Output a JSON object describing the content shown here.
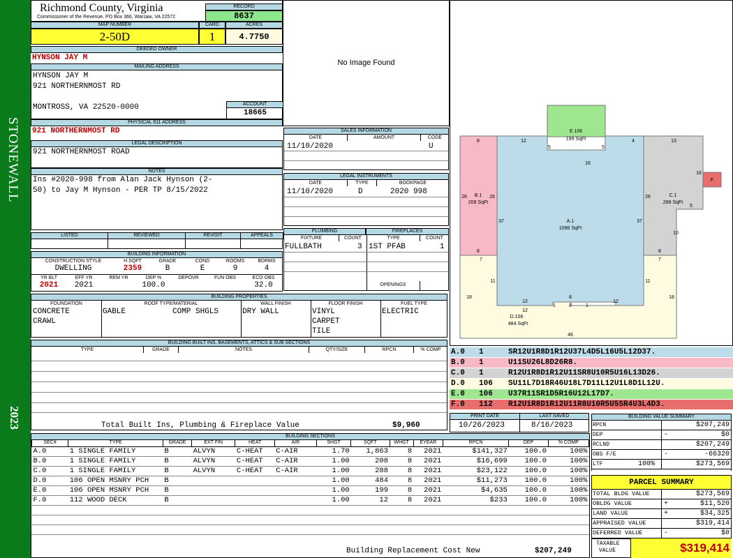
{
  "sidebar": {
    "district": "STONEWALL",
    "year": "2023",
    "color": "#0a7a1a"
  },
  "header": {
    "county": "Richmond County, Virginia",
    "office": "Commissioner of the Revenue, PO Box 366, Warsaw, VA 22572",
    "record_label": "RECORD",
    "record": "8637",
    "map_label": "MAP NUMBER",
    "map_number": "2-50D",
    "card_label": "CARD",
    "card": "1",
    "acres_label": "ACRES",
    "acres": "4.7750"
  },
  "owner": {
    "label": "DEEDED OWNER",
    "name": "HYNSON JAY M"
  },
  "mailing": {
    "label": "MAILING ADDRESS",
    "line1": "HYNSON JAY M",
    "line2": "921 NORTHERNMOST RD",
    "line3": "MONTROSS, VA 22520-0000"
  },
  "account": {
    "label": "ACCOUNT",
    "value": "18665"
  },
  "physical": {
    "label": "PHYSICAL 911 ADDRESS",
    "value": "921 NORTHERNMOST RD"
  },
  "legal": {
    "label": "LEGAL DESCRIPTION",
    "value": "921 NORTHERNMOST ROAD"
  },
  "notes": {
    "label": "NOTES",
    "line1": "Ins #2020-998 from Alan Jack Hynson (2-",
    "line2": "50) to Jay M Hynson - PER TP 8/15/2022"
  },
  "review": {
    "listed": "LISTED",
    "reviewed": "REVIEWED",
    "revisit": "REVISIT",
    "appeals": "APPEALS"
  },
  "building": {
    "label": "BUILDING INFORMATION",
    "h_style": "CONSTRUCTION STYLE",
    "h_hsqft": "H SQFT",
    "h_grade": "GRADE",
    "h_cond": "COND",
    "h_rooms": "ROOMS",
    "h_bdrms": "BDRMS",
    "style": "DWELLING",
    "hsqft": "2359",
    "grade": "B",
    "cond": "E",
    "rooms": "9",
    "bdrms": "4",
    "h_yrblt": "YR BLT",
    "h_effyr": "EFF YR",
    "h_remyr": "REM YR",
    "h_dep": "DEP %",
    "h_depovr": "DEPOVR",
    "h_funobs": "FUN OBS",
    "h_ecoobs": "ECO OBS",
    "yrblt": "2021",
    "effyr": "2021",
    "remyr": "",
    "dep": "100.0",
    "depovr": "",
    "funobs": "",
    "ecoobs": "32.0"
  },
  "properties": {
    "label": "BUILDING PROPERTIES",
    "h_foundation": "FOUNDATION",
    "h_roof": "ROOF TYPE/MATERIAL",
    "h_wall": "WALL FINISH",
    "h_floor": "FLOOR FINISH",
    "h_fuel": "FUEL TYPE",
    "foundation1": "CONCRETE",
    "foundation2": "CRAWL",
    "roof_type": "GABLE",
    "roof_mat": "COMP SHGLS",
    "wall": "DRY WALL",
    "floor1": "VINYL",
    "floor2": "CARPET",
    "floor3": "TILE",
    "fuel": "ELECTRIC"
  },
  "builtins": {
    "label": "BUILDING BUILT INS, BASEMENTS, ATTICS & SUB SECTIONS",
    "h_type": "TYPE",
    "h_grade": "GRADE",
    "h_notes": "NOTES",
    "h_qty": "QTY/SIZE",
    "h_rpcn": "RPCN",
    "h_comp": "% COMP",
    "total_label": "Total Built Ins, Plumbing & Fireplace Value",
    "total": "$9,960"
  },
  "image": {
    "text": "No Image Found"
  },
  "sales": {
    "label": "SALES INFORMATION",
    "h_date": "DATE",
    "h_amount": "AMOUNT",
    "h_code": "CODE",
    "date": "11/10/2020",
    "amount": "",
    "code": "U"
  },
  "legal_inst": {
    "label": "LEGAL INSTRUMENTS",
    "h_date": "DATE",
    "h_type": "TYPE",
    "h_book": "BOOKPAGE",
    "date": "11/10/2020",
    "type": "D",
    "book": "2020 998"
  },
  "plumbing": {
    "label": "PLUMBING",
    "h_fixture": "FIXTURE",
    "h_count": "COUNT",
    "fixture": "FULLBATH",
    "count": "3"
  },
  "fireplaces": {
    "label": "FIREPLACES",
    "h_type": "TYPE",
    "h_count": "COUNT",
    "type": "1ST PFAB",
    "count": "1",
    "openings": "OPENINGS"
  },
  "sketch": {
    "labels": {
      "E": "E.106",
      "E_sq": "199 SqFt",
      "B": "B.1",
      "B_sq": "208 SqFt",
      "A": "A.1",
      "A_sq": "1096 SqFt",
      "C": "C.1",
      "C_sq": "288 SqFt",
      "D": "D.106",
      "D_sq": "484 SqFt",
      "F": "F"
    },
    "dims": {
      "b_top": "8",
      "a_top_l": "12",
      "e_l": "5",
      "e_r": "5",
      "e_b": "16",
      "a_top_r": "4",
      "c_top": "13",
      "f_l": "16",
      "b_l": "26",
      "b_r": "26",
      "c_l": "26",
      "c_r": "5",
      "a_l": "37",
      "a_r": "37",
      "c_bot": "10",
      "b_bot": "8",
      "c_b2": "8",
      "d_tl": "7",
      "d_tr": "7",
      "d_l": "11",
      "d_r": "11",
      "d_ls": "18",
      "d_rs": "18",
      "a_b1": "12",
      "a_b2": "8",
      "a_b3": "12",
      "a_b4": "12",
      "a_b5": "1",
      "a_b6": "8",
      "a_b7": "1",
      "d_bot": "46"
    },
    "colors": {
      "A": "#bcdce9",
      "B": "#f7b9c6",
      "C": "#d3d3d3",
      "D": "#fffbe0",
      "E": "#9ee68f",
      "F": "#e86d6d"
    }
  },
  "legend": [
    {
      "code": "A.0",
      "num": "1",
      "path": "SR12U1R8D1R12U37L4D5L16U5L12D37.",
      "color": "#bcdce9"
    },
    {
      "code": "B.0",
      "num": "1",
      "path": "U11SU26L8D26R8.",
      "color": "#f7b9c6"
    },
    {
      "code": "C.0",
      "num": "1",
      "path": "R12U1R8D1R12U11SR8U10R5U16L13D26.",
      "color": "#d3d3d3"
    },
    {
      "code": "D.0",
      "num": "106",
      "path": "SU11L7D18R46U18L7D11L12U1L8D1L12U.",
      "color": "#fffbe0"
    },
    {
      "code": "E.0",
      "num": "106",
      "path": "U37R11SR1D5R16U12L17D7.",
      "color": "#9ee68f"
    },
    {
      "code": "F.0",
      "num": "112",
      "path": "R12U1R8D1R12U11R8U10R5U5SR4U3L4D3.",
      "color": "#e86d6d"
    }
  ],
  "dates": {
    "h_print": "PRINT DATE",
    "h_saved": "LAST SAVED",
    "print": "10/26/2023",
    "saved": "8/16/2023"
  },
  "sections": {
    "label": "BUILDING SECTIONS",
    "headers": [
      "SEC#",
      "TYPE",
      "GRADE",
      "EXT FIN",
      "HEAT",
      "AIR",
      "SHGT",
      "SQFT",
      "WHGT",
      "EYEAR",
      "RPCN",
      "DEP",
      "% COMP"
    ],
    "rows": [
      [
        "A.0",
        "1 SINGLE FAMILY",
        "B",
        "ALVYN",
        "C-HEAT",
        "C-AIR",
        "1.70",
        "1,863",
        "8",
        "2021",
        "$141,327",
        "100.0",
        "100%"
      ],
      [
        "B.0",
        "1 SINGLE FAMILY",
        "B",
        "ALVYN",
        "C-HEAT",
        "C-AIR",
        "1.00",
        "208",
        "8",
        "2021",
        "$16,699",
        "100.0",
        "100%"
      ],
      [
        "C.0",
        "1 SINGLE FAMILY",
        "B",
        "ALVYN",
        "C-HEAT",
        "C-AIR",
        "1.00",
        "288",
        "8",
        "2021",
        "$23,122",
        "100.0",
        "100%"
      ],
      [
        "D.0",
        "106 OPEN MSNRY PCH",
        "B",
        "",
        "",
        "",
        "1.00",
        "484",
        "8",
        "2021",
        "$11,273",
        "100.0",
        "100%"
      ],
      [
        "E.0",
        "106 OPEN MSNRY PCH",
        "B",
        "",
        "",
        "",
        "1.00",
        "199",
        "8",
        "2021",
        "$4,635",
        "100.0",
        "100%"
      ],
      [
        "F.0",
        "112 WOOD DECK",
        "B",
        "",
        "",
        "",
        "1.00",
        "12",
        "8",
        "2021",
        "$233",
        "100.0",
        "100%"
      ]
    ],
    "total_label": "Building Replacement Cost New",
    "total": "$207,249"
  },
  "bvs": {
    "label": "BUILDING VALUE SUMMARY",
    "rpcn_l": "RPCN",
    "rpcn": "$207,249",
    "dep_l": "DEP",
    "dep_s": "-",
    "dep": "$0",
    "rclnd_l": "RCLND",
    "rclnd": "$207,249",
    "obs_l": "OBS F/E",
    "obs_s": "-",
    "obs": "-66320",
    "ltr_l": "LTF",
    "ltr_p": "100%",
    "ltr": "$273,569"
  },
  "parcel": {
    "label": "PARCEL SUMMARY",
    "tbv_l": "TOTAL BLDG VALUE",
    "tbv": "$273,569",
    "obv_l": "OBLDG VALUE",
    "obv_s": "+",
    "obv": "$11,520",
    "land_l": "LAND VALUE",
    "land_s": "+",
    "land": "$34,325",
    "app_l": "APPRAISED VALUE",
    "app": "$319,414",
    "def_l": "DEFERRED VALUE",
    "def_s": "-",
    "def": "$0",
    "tax_l1": "TAXABLE",
    "tax_l2": "VALUE",
    "tax": "$319,414"
  }
}
